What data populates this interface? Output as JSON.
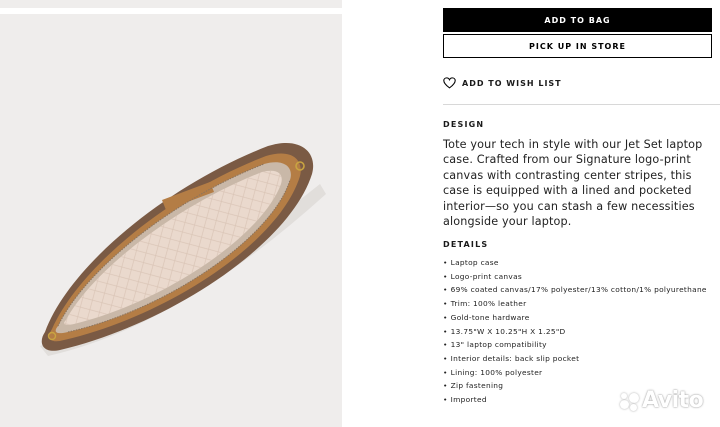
{
  "actions": {
    "add_to_bag": "ADD TO BAG",
    "pick_up_in_store": "PICK UP IN STORE",
    "add_to_wish_list": "ADD TO WISH LIST"
  },
  "design": {
    "heading": "DESIGN",
    "description": "Tote your tech in style with our Jet Set laptop case. Crafted from our Signature logo-print canvas with contrasting center stripes, this case is equipped with a lined and pocketed interior—so you can stash a few necessities alongside your laptop."
  },
  "details": {
    "heading": "DETAILS",
    "items": [
      "Laptop case",
      "Logo-print canvas",
      "69% coated canvas/17% polyester/13% cotton/1% polyurethane",
      "Trim: 100% leather",
      "Gold-tone hardware",
      "13.75\"W X 10.25\"H X 1.25\"D",
      "13\" laptop compatibility",
      "Interior details: back slip pocket",
      "Lining: 100% polyester",
      "Zip fastening",
      "Imported"
    ]
  },
  "watermark": {
    "text": "Avito"
  },
  "colors": {
    "primary_button_bg": "#000000",
    "primary_button_text": "#ffffff",
    "image_background": "#efedec",
    "case_trim": "#b47d45",
    "case_lining": "#e9d8cc"
  },
  "icons": {
    "wish": "heart-icon",
    "watermark": "avito-logo-icon"
  }
}
